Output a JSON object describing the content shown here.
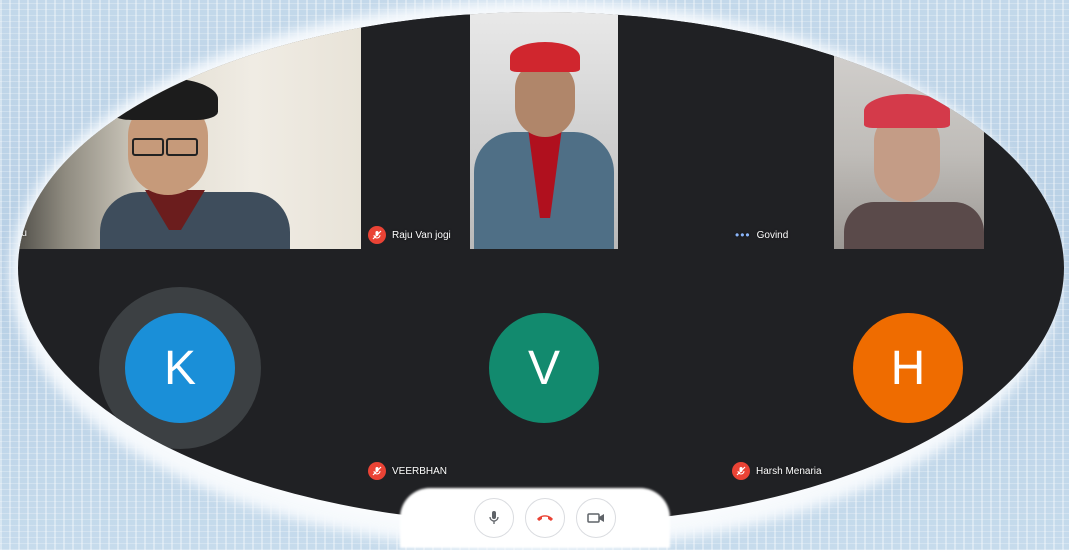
{
  "participants": {
    "you": {
      "label": "You"
    },
    "raju": {
      "label": "Raju Van jogi"
    },
    "center_video": {
      "label": ""
    },
    "govind": {
      "label": "Govind"
    },
    "right_video": {
      "label": ""
    },
    "k": {
      "initial": "K",
      "color": "#1a8fd8",
      "label": ""
    },
    "v": {
      "initial": "V",
      "color": "#128a6e",
      "label": "VEERBHAN"
    },
    "h": {
      "initial": "H",
      "color": "#ef6c00",
      "label": "Harsh Menaria"
    }
  },
  "controls": {
    "mic_icon": "mic-icon",
    "end_call_icon": "end-call-icon",
    "camera_icon": "camera-icon"
  }
}
